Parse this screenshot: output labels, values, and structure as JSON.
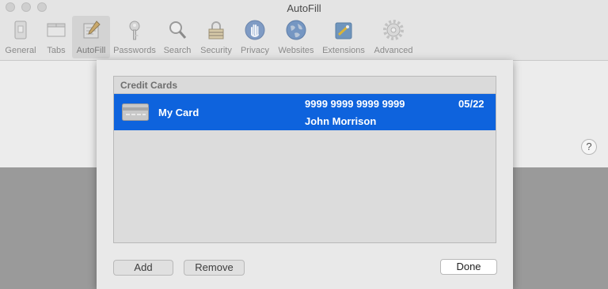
{
  "window": {
    "title": "AutoFill"
  },
  "toolbar": {
    "items": [
      {
        "label": "General",
        "icon": "general-icon"
      },
      {
        "label": "Tabs",
        "icon": "tabs-icon"
      },
      {
        "label": "AutoFill",
        "icon": "autofill-icon",
        "selected": true
      },
      {
        "label": "Passwords",
        "icon": "key-icon"
      },
      {
        "label": "Search",
        "icon": "magnifier-icon"
      },
      {
        "label": "Security",
        "icon": "lock-icon"
      },
      {
        "label": "Privacy",
        "icon": "hand-icon"
      },
      {
        "label": "Websites",
        "icon": "globe-icon"
      },
      {
        "label": "Extensions",
        "icon": "puzzle-icon"
      },
      {
        "label": "Advanced",
        "icon": "gear-icon"
      }
    ]
  },
  "help": {
    "label": "?"
  },
  "sheet": {
    "table_header": "Credit Cards",
    "cards": [
      {
        "name": "My Card",
        "number": "9999 9999 9999 9999",
        "holder": "John Morrison",
        "expiry": "05/22"
      }
    ],
    "buttons": {
      "add": "Add",
      "remove": "Remove",
      "done": "Done"
    }
  },
  "colors": {
    "selection": "#0e63dd",
    "background": "#9a9a9a"
  }
}
